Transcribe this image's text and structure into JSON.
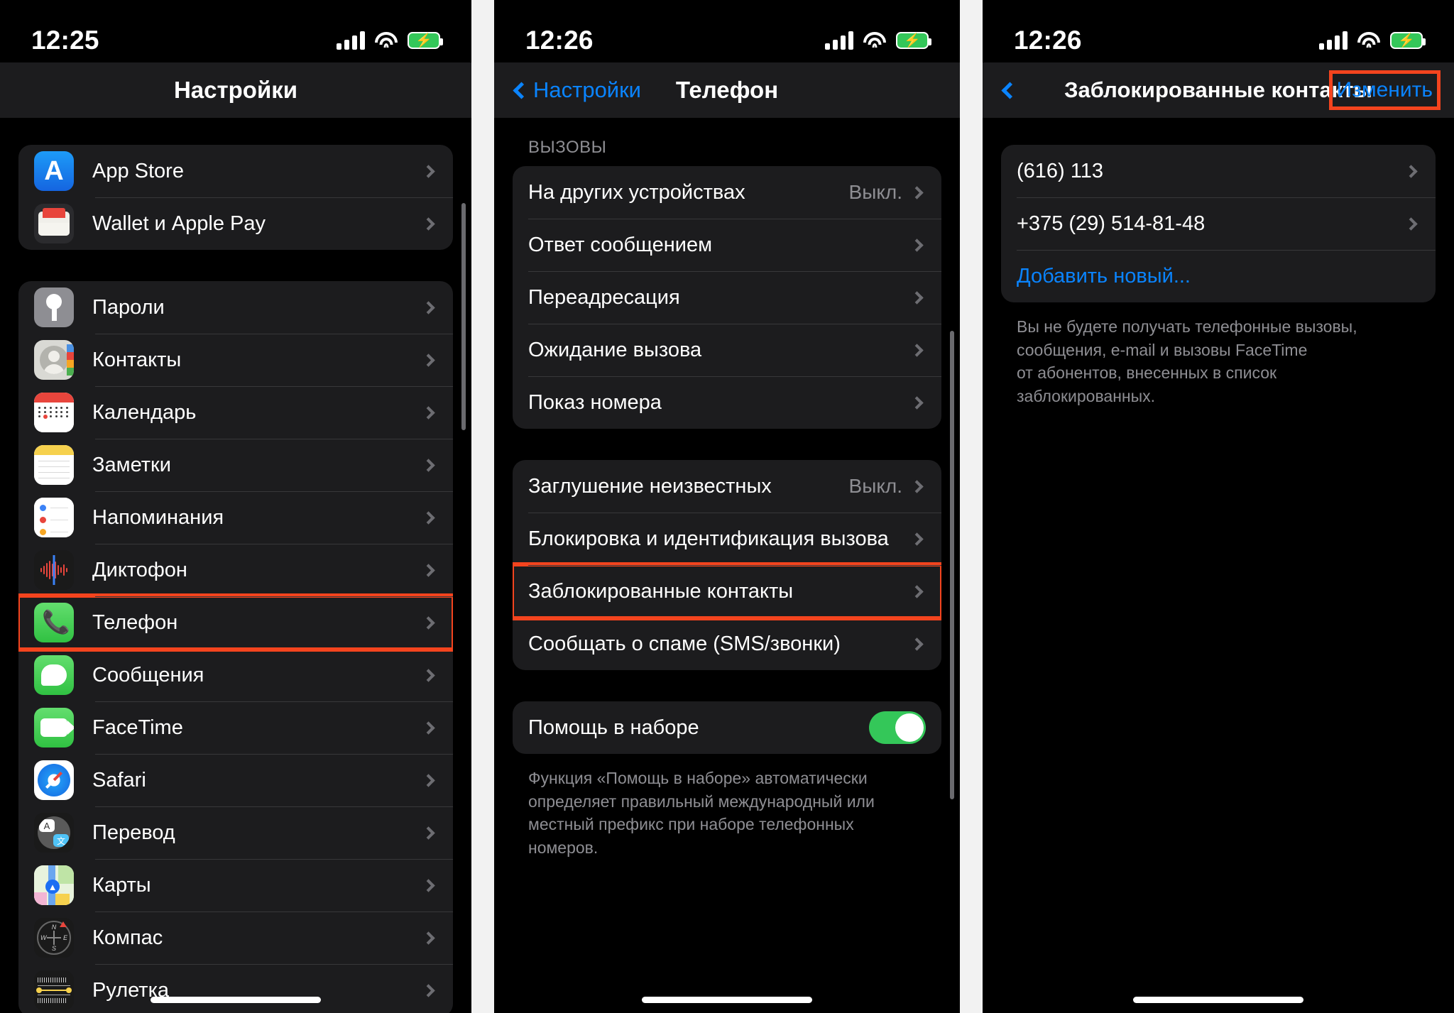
{
  "panels": {
    "settings": {
      "status": {
        "time": "12:25"
      },
      "nav": {
        "title": "Настройки"
      },
      "group1": [
        {
          "label": "App Store",
          "icon": "appstore-icon"
        },
        {
          "label": "Wallet и Apple Pay",
          "icon": "wallet-icon"
        }
      ],
      "group2": [
        {
          "label": "Пароли",
          "icon": "passwords-key-icon"
        },
        {
          "label": "Контакты",
          "icon": "contacts-icon"
        },
        {
          "label": "Календарь",
          "icon": "calendar-icon"
        },
        {
          "label": "Заметки",
          "icon": "notes-icon"
        },
        {
          "label": "Напоминания",
          "icon": "reminders-icon"
        },
        {
          "label": "Диктофон",
          "icon": "voice-memos-icon"
        },
        {
          "label": "Телефон",
          "icon": "phone-icon",
          "highlighted": true
        },
        {
          "label": "Сообщения",
          "icon": "messages-icon"
        },
        {
          "label": "FaceTime",
          "icon": "facetime-icon"
        },
        {
          "label": "Safari",
          "icon": "safari-icon"
        },
        {
          "label": "Перевод",
          "icon": "translate-icon"
        },
        {
          "label": "Карты",
          "icon": "maps-icon"
        },
        {
          "label": "Компас",
          "icon": "compass-icon"
        },
        {
          "label": "Рулетка",
          "icon": "measure-icon"
        }
      ]
    },
    "phone": {
      "status": {
        "time": "12:26"
      },
      "nav": {
        "back_label": "Настройки",
        "title": "Телефон"
      },
      "section1_header": "ВЫЗОВЫ",
      "section1": [
        {
          "label": "На других устройствах",
          "value": "Выкл."
        },
        {
          "label": "Ответ сообщением",
          "value": ""
        },
        {
          "label": "Переадресация",
          "value": ""
        },
        {
          "label": "Ожидание вызова",
          "value": ""
        },
        {
          "label": "Показ номера",
          "value": ""
        }
      ],
      "section2": [
        {
          "label": "Заглушение неизвестных",
          "value": "Выкл."
        },
        {
          "label": "Блокировка и идентификация вызова",
          "value": ""
        },
        {
          "label": "Заблокированные контакты",
          "value": "",
          "highlighted": true
        },
        {
          "label": "Сообщать о спаме (SMS/звонки)",
          "value": ""
        }
      ],
      "section3": {
        "label": "Помощь в наборе",
        "toggle_on": true,
        "footer": "Функция «Помощь в наборе» автоматически\nопределяет правильный международный или\nместный префикс при наборе телефонных\nномеров."
      }
    },
    "blocked": {
      "status": {
        "time": "12:26"
      },
      "nav": {
        "title": "Заблокированные контакты",
        "action_label": "Изменить"
      },
      "rows": [
        {
          "label": "(616) 113",
          "type": "contact"
        },
        {
          "label": "+375 (29) 514-81-48",
          "type": "contact"
        },
        {
          "label": "Добавить новый...",
          "type": "action"
        }
      ],
      "footer": "Вы не будете получать телефонные вызовы,\nсообщения, e-mail и вызовы FaceTime\nот абонентов, внесенных в список\nзаблокированных."
    }
  },
  "colors": {
    "accent_blue": "#0a84ff",
    "highlight_red": "#f4441e",
    "toggle_green": "#34c759",
    "group_bg": "#1c1c1e",
    "secondary_text": "#8e8e93"
  }
}
